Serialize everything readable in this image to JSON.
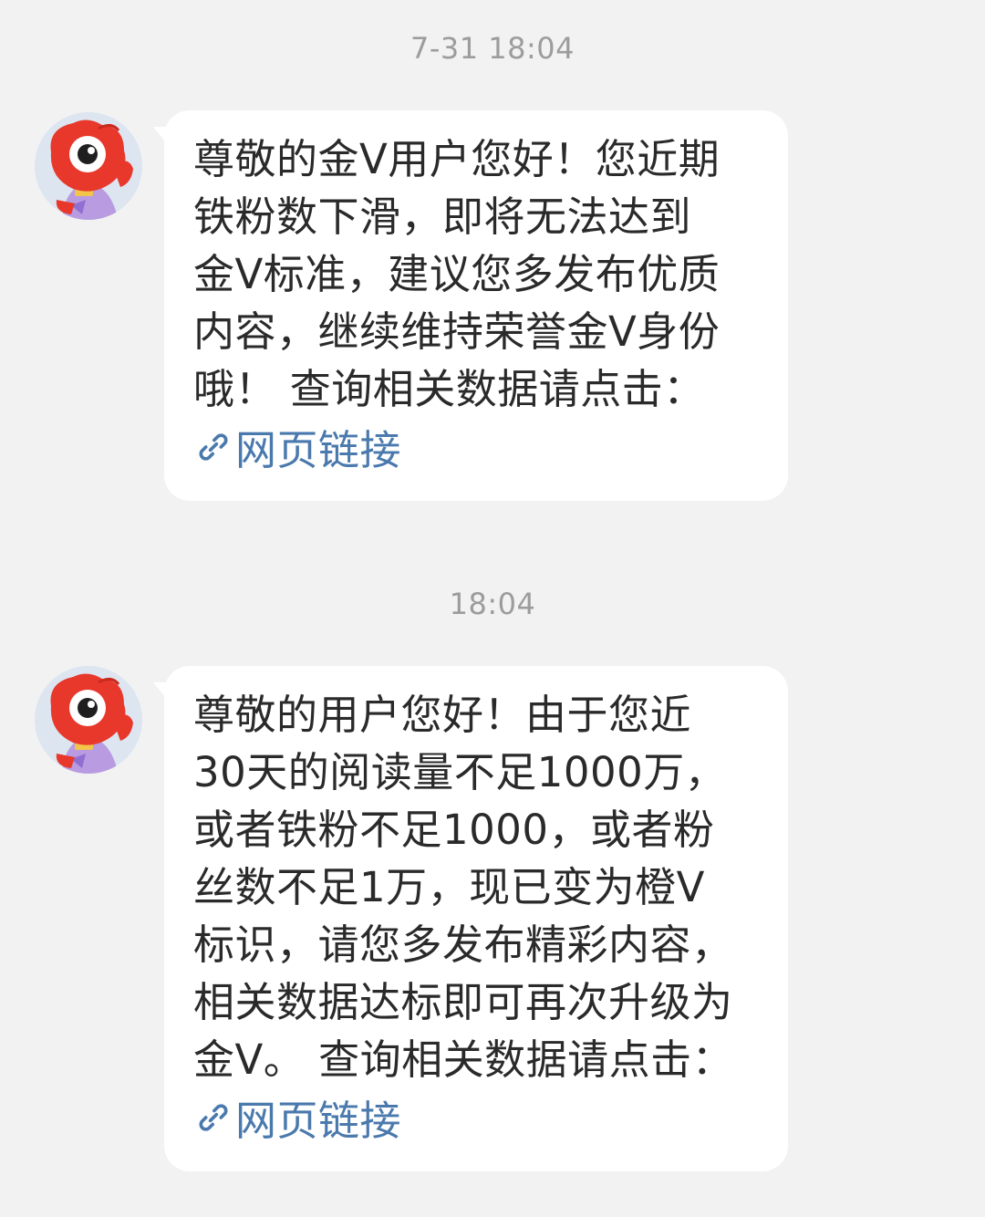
{
  "messages": [
    {
      "timestamp": "7-31 18:04",
      "avatar_icon": "weibo-mascot-avatar-icon",
      "lines": [
        "尊敬的金V用户您好！您近期",
        "铁粉数下滑，即将无法达到",
        "金V标准，建议您多发布优质",
        "内容，继续维持荣誉金V身份",
        "哦！ 查询相关数据请点击："
      ],
      "link_label": "网页链接",
      "link_icon": "link-icon"
    },
    {
      "timestamp": "18:04",
      "avatar_icon": "weibo-mascot-avatar-icon",
      "lines": [
        "尊敬的用户您好！由于您近",
        "30天的阅读量不足1000万，",
        "或者铁粉不足1000，或者粉",
        "丝数不足1万，现已变为橙V",
        "标识，请您多发布精彩内容，",
        "相关数据达标即可再次升级为",
        "金V。 查询相关数据请点击："
      ],
      "link_label": "网页链接",
      "link_icon": "link-icon"
    }
  ],
  "colors": {
    "background": "#f2f2f2",
    "bubble": "#ffffff",
    "text": "#2a2a2a",
    "timestamp": "#9c9c9c",
    "link": "#4a79ad",
    "mascot_red": "#e8382c"
  }
}
